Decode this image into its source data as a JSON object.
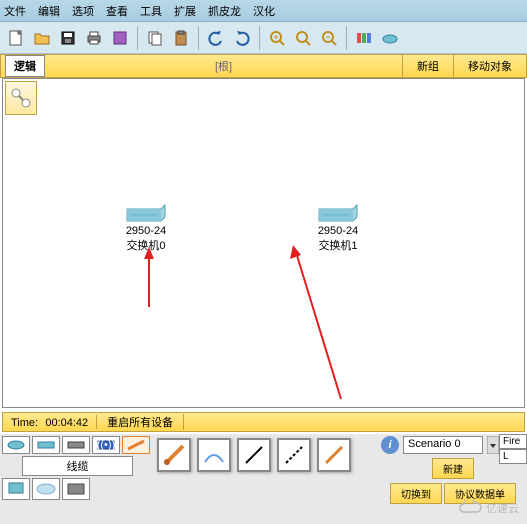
{
  "menu": {
    "file": "文件",
    "edit": "编辑",
    "options": "选项",
    "view": "查看",
    "tools": "工具",
    "extensions": "扩展",
    "prefs": "抓皮龙",
    "locale": "汉化"
  },
  "logic_tab": "逻辑",
  "root_label": "[根]",
  "new_cluster": "新组",
  "move_object": "移动对象",
  "devices": {
    "switch0": {
      "model": "2950-24",
      "name": "交换机0"
    },
    "switch1": {
      "model": "2950-24",
      "name": "交换机1"
    }
  },
  "time": {
    "label": "Time:",
    "value": "00:04:42"
  },
  "reset_devices": "重启所有设备",
  "category_label": "线缆",
  "scenario": {
    "selected": "Scenario 0"
  },
  "scenario_buttons": {
    "new": "新建",
    "switch": "切换到",
    "list": "协议数据单"
  },
  "fire": "Fire",
  "la": "L",
  "watermark": "亿速云"
}
